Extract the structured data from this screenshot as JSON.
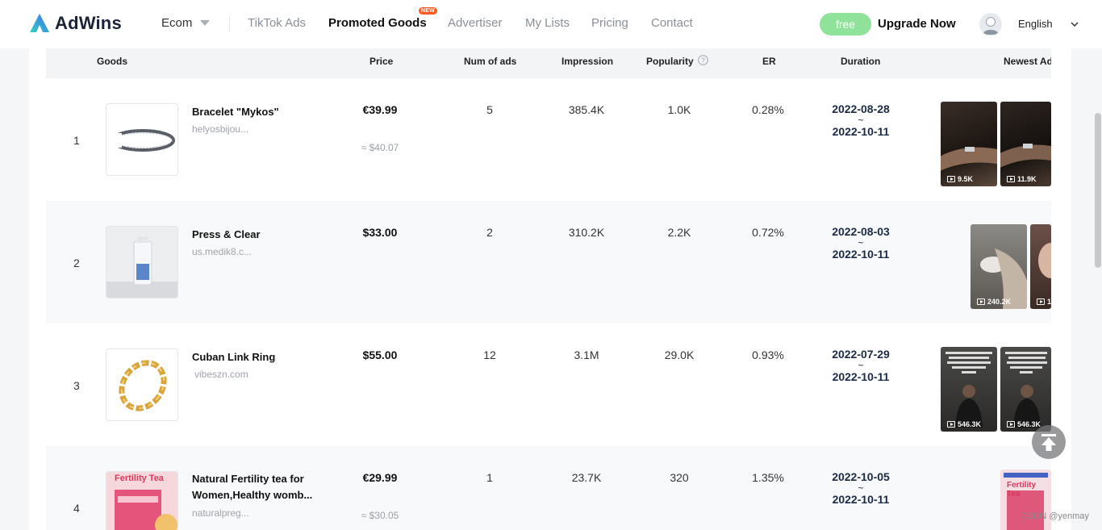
{
  "nav": {
    "logo": "AdWins",
    "items": [
      "Ecom",
      "TikTok Ads",
      "Promoted Goods",
      "Advertiser",
      "My Lists",
      "Pricing",
      "Contact"
    ],
    "new_badge": "NEW",
    "free": "free",
    "upgrade": "Upgrade Now",
    "language": "English"
  },
  "table": {
    "headers": [
      "Goods",
      "Price",
      "Num of ads",
      "Impression",
      "Popularity",
      "ER",
      "Duration",
      "Newest Ad"
    ],
    "rows": [
      {
        "rank": "1",
        "name": "Bracelet \"Mykos\"",
        "shop": "helyosbijou...",
        "price": "€39.99",
        "price_usd": "≈ $40.07",
        "num_ads": "5",
        "impression": "385.4K",
        "popularity": "1.0K",
        "er": "0.28%",
        "date_from": "2022-08-28",
        "tilde": "~",
        "date_to": "2022-10-11",
        "ads": [
          "9.5K",
          "11.9K"
        ]
      },
      {
        "rank": "2",
        "name": "Press & Clear",
        "shop": "us.medik8.c...",
        "price": "$33.00",
        "price_usd": "",
        "num_ads": "2",
        "impression": "310.2K",
        "popularity": "2.2K",
        "er": "0.72%",
        "date_from": "2022-08-03",
        "tilde": "~",
        "date_to": "2022-10-11",
        "ads": [
          "240.2K",
          "1"
        ]
      },
      {
        "rank": "3",
        "name": "Cuban Link Ring",
        "shop": "vibeszn.com",
        "price": "$55.00",
        "price_usd": "",
        "num_ads": "12",
        "impression": "3.1M",
        "popularity": "29.0K",
        "er": "0.93%",
        "date_from": "2022-07-29",
        "tilde": "~",
        "date_to": "2022-10-11",
        "ads": [
          "546.3K",
          "546.3K"
        ]
      },
      {
        "rank": "4",
        "name": "Natural Fertility tea for",
        "name2": "Women,Healthy womb...",
        "shop": "naturalpreg...",
        "price": "€29.99",
        "price_usd": "≈ $30.05",
        "num_ads": "1",
        "impression": "23.7K",
        "popularity": "320",
        "er": "1.35%",
        "date_from": "2022-10-05",
        "tilde": "~",
        "date_to": "2022-10-11",
        "ads": []
      }
    ]
  },
  "product_text": {
    "fertility_tea": "Fertility Tea"
  },
  "watermark": "CSDN @yenmay",
  "colors": {
    "accent": "#8ee29a",
    "new_badge": "#ff5a1f",
    "date_text": "#1b2b45"
  }
}
